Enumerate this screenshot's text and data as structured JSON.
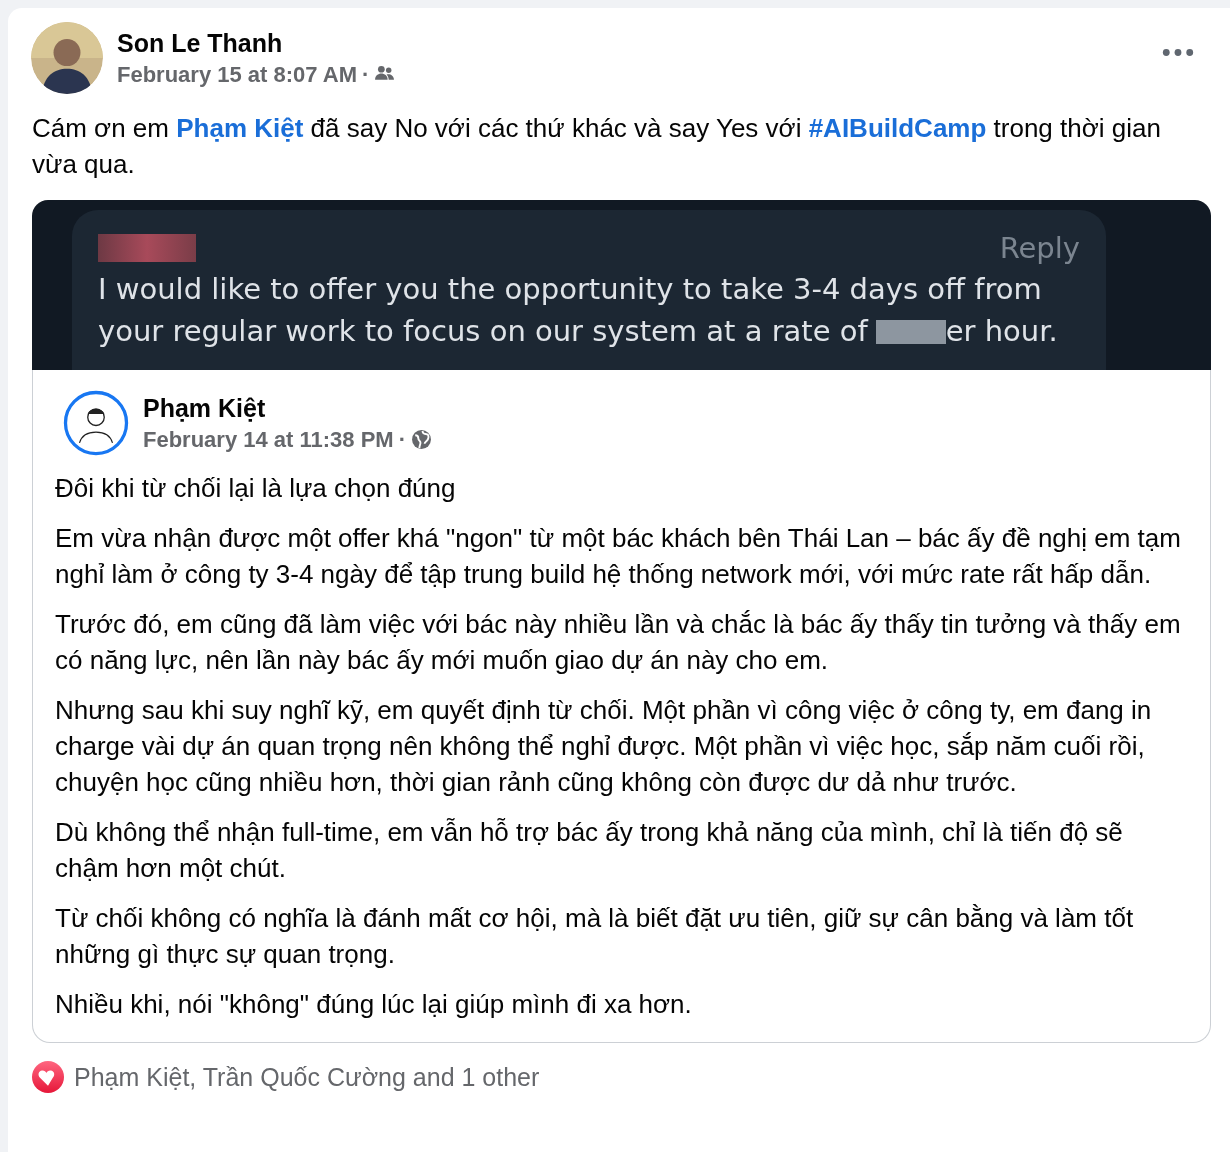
{
  "post": {
    "author": "Son Le Thanh",
    "time": "February 15 at 8:07 AM",
    "separator": "·",
    "audience": {
      "kind": "friends"
    },
    "caption": [
      {
        "kind": "text",
        "text": "Cám ơn em "
      },
      {
        "kind": "mention",
        "text": "Phạm Kiệt"
      },
      {
        "kind": "text",
        "text": " đã say No với các thứ khác và say Yes với "
      },
      {
        "kind": "hashtag",
        "text": "#AIBuildCamp"
      },
      {
        "kind": "text",
        "text": " trong thời gian vừa qua."
      }
    ],
    "image": {
      "reply": "Reply",
      "lines": [
        "I would like to offer you the opportunity to take 3-4 days off from",
        "your regular work to focus on our system at a rate of"
      ],
      "tail": "er hour."
    },
    "shared": {
      "author": "Phạm Kiệt",
      "time": "February 14 at 11:38 PM",
      "separator": "·",
      "audience": {
        "kind": "public"
      },
      "paragraphs": [
        "Đôi khi từ chối lại là lựa chọn đúng",
        "Em vừa nhận được một offer khá \"ngon\" từ một bác khách bên Thái Lan – bác ấy đề nghị em tạm nghỉ làm ở công ty 3-4 ngày để tập trung build hệ thống network mới, với mức rate rất hấp dẫn.",
        "Trước đó, em cũng đã làm việc với bác này nhiều lần và chắc là bác ấy thấy tin tưởng và thấy em có năng lực, nên lần này bác ấy mới muốn giao dự án này cho em.",
        "Nhưng sau khi suy nghĩ kỹ, em quyết định từ chối. Một phần vì công việc ở công ty, em đang in charge vài dự án quan trọng nên không thể nghỉ được. Một phần vì việc học, sắp năm cuối rồi, chuyện học cũng nhiều hơn, thời gian rảnh cũng không còn được dư dả như trước.",
        "Dù không thể nhận full-time, em vẫn hỗ trợ bác ấy trong khả năng của mình, chỉ là tiến độ sẽ chậm hơn một chút.",
        "Từ chối không có nghĩa là đánh mất cơ hội, mà là biết đặt ưu tiên, giữ sự cân bằng và làm tốt những gì thực sự quan trọng.",
        "Nhiều khi, nói \"không\" đúng lúc lại giúp mình đi xa hơn."
      ]
    },
    "reactions": "Phạm Kiệt, Trần Quốc Cường and 1 other"
  }
}
